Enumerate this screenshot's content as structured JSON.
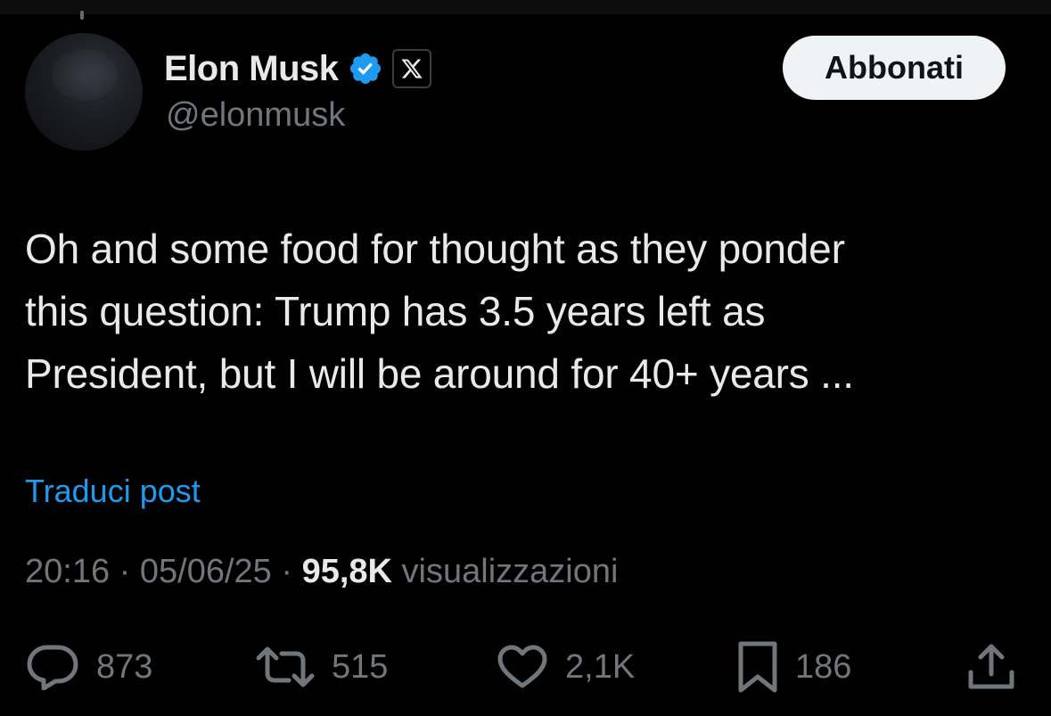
{
  "author": {
    "name": "Elon Musk",
    "handle": "@elonmusk"
  },
  "follow_button": {
    "label": "Abbonati"
  },
  "tweet": {
    "lines": [
      "Oh and some food for thought as they ponder",
      "this question: Trump has 3.5 years left as",
      "President, but I will be around for 40+ years ..."
    ],
    "translate_label": "Traduci post"
  },
  "meta": {
    "time": "20:16",
    "separator": "·",
    "date": "05/06/25",
    "views_count": "95,8K",
    "views_label": "visualizzazioni"
  },
  "actions": {
    "replies": {
      "icon": "reply-icon",
      "count": "873"
    },
    "reposts": {
      "icon": "repost-icon",
      "count": "515"
    },
    "likes": {
      "icon": "heart-icon",
      "count": "2,1K"
    },
    "bookmarks": {
      "icon": "bookmark-icon",
      "count": "186"
    },
    "share": {
      "icon": "share-icon"
    }
  },
  "colors": {
    "background": "#000000",
    "text": "#e7e9ea",
    "muted": "#71767b",
    "link": "#1d9bf0",
    "verified": "#1d9bf0",
    "button_bg": "#eff3f4"
  }
}
